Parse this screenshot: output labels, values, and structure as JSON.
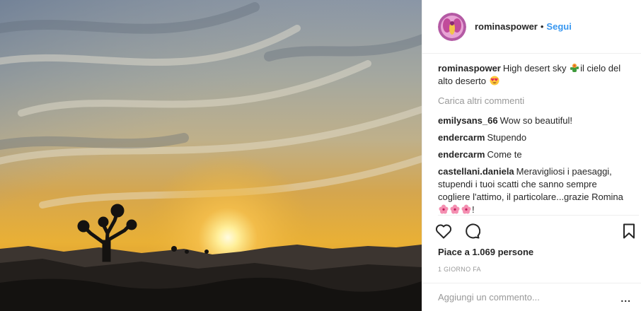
{
  "post": {
    "image_alt": "",
    "author": "rominaspower",
    "separator": "•",
    "follow_label": "Segui"
  },
  "caption": {
    "user": "rominaspower",
    "text_before_emoji": "High desert sky ",
    "text_after_emoji": "il cielo del alto deserto ",
    "emoji_1": "cactus-flower-emoji",
    "emoji_2": "heart-eyes-emoji"
  },
  "load_more": "Carica altri commenti",
  "comments": [
    {
      "user": "emilysans_66",
      "text": "Wow so beautiful!"
    },
    {
      "user": "endercarm",
      "text": "Stupendo"
    },
    {
      "user": "endercarm",
      "text": "Come te"
    },
    {
      "user": "castellani.daniela",
      "text": "Meravigliosi i paesaggi, stupendi i tuoi scatti che sanno sempre cogliere l'attimo, il particolare...grazie Romina ",
      "suffix": "!"
    }
  ],
  "actions": {
    "like_icon": "heart-outline-icon",
    "comment_icon": "speech-bubble-icon",
    "save_icon": "bookmark-icon"
  },
  "likes_text": "Piace a 1.069 persone",
  "timestamp": "1 GIORNO FA",
  "add_comment_placeholder": "Aggiungi un commento...",
  "options": "...",
  "colors": {
    "link": "#3897f0",
    "muted": "#999999",
    "text": "#262626"
  }
}
